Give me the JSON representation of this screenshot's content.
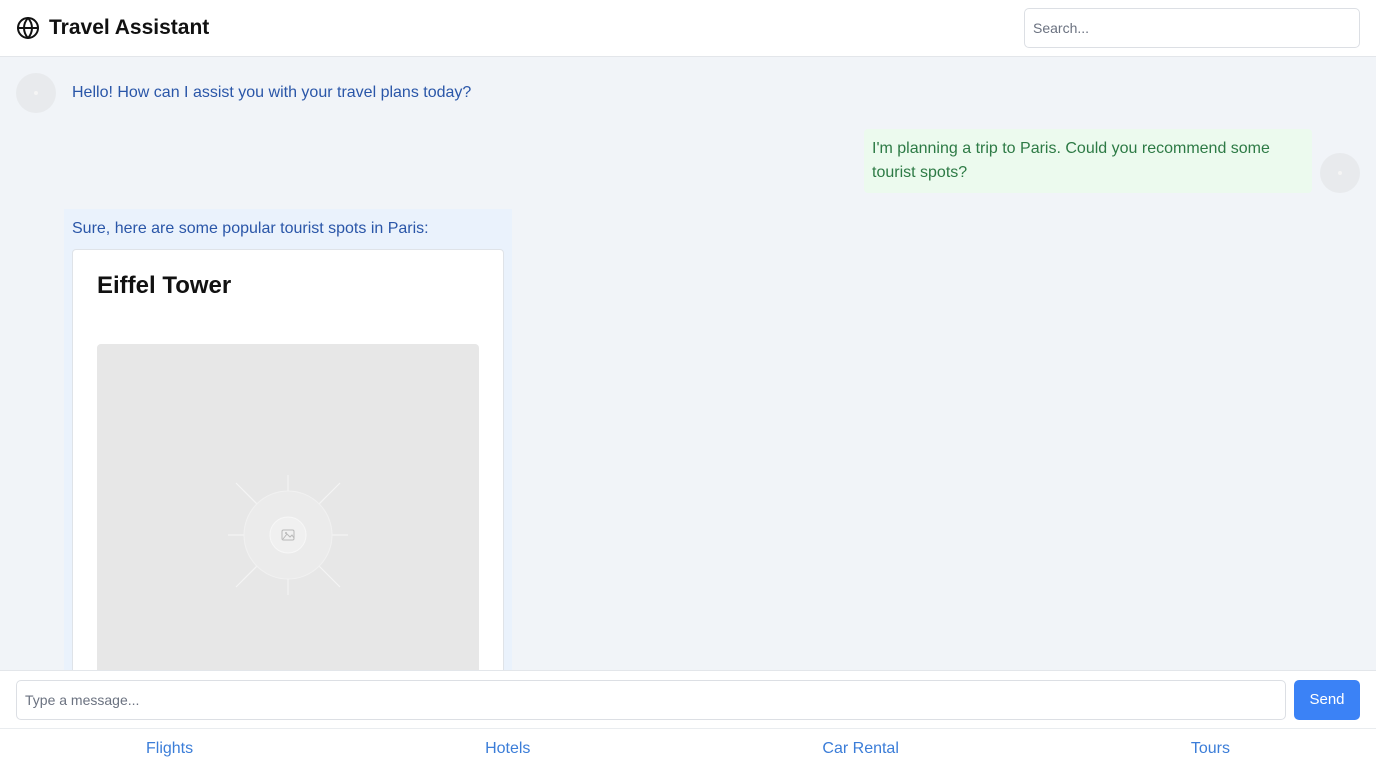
{
  "header": {
    "title": "Travel Assistant",
    "icon": "globe-icon",
    "search_placeholder": "Search..."
  },
  "messages": [
    {
      "role": "assistant",
      "text": "Hello! How can I assist you with your travel plans today?"
    },
    {
      "role": "user",
      "text": "I'm planning a trip to Paris. Could you recommend some tourist spots?"
    },
    {
      "role": "assistant",
      "text": "Sure, here are some popular tourist spots in Paris:",
      "cards": [
        {
          "title": "Eiffel Tower",
          "image_icon": "image-placeholder-icon"
        }
      ]
    }
  ],
  "composer": {
    "placeholder": "Type a message...",
    "send_label": "Send"
  },
  "nav": {
    "items": [
      {
        "label": "Flights"
      },
      {
        "label": "Hotels"
      },
      {
        "label": "Car Rental"
      },
      {
        "label": "Tours"
      }
    ]
  },
  "colors": {
    "accent": "#3b82f6",
    "assistant_text": "#2a56a8",
    "user_text": "#2d7a45",
    "user_bubble": "#ecfaee",
    "assistant_bubble": "#eaf2fc",
    "background": "#f1f4f8"
  }
}
